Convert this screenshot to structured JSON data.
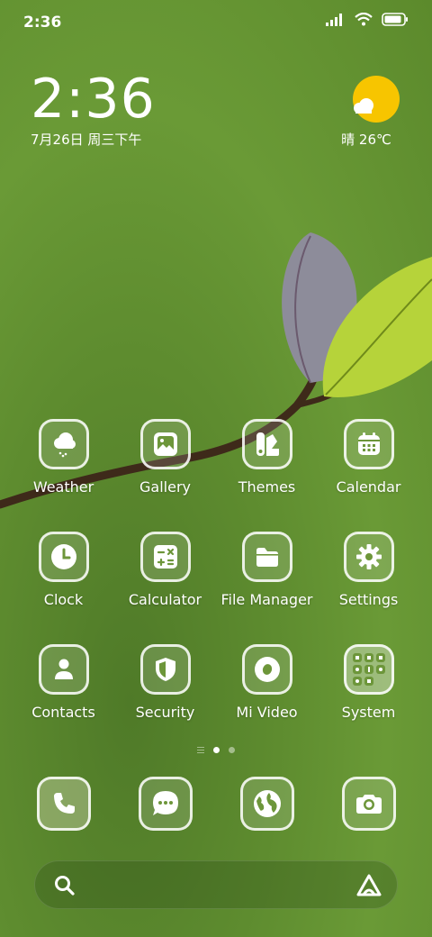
{
  "status_bar": {
    "time": "2:36",
    "battery_level": 0.9
  },
  "clock_widget": {
    "time": "2:36",
    "date": "7月26日 周三下午"
  },
  "weather_widget": {
    "text": "晴 26℃"
  },
  "apps": [
    {
      "label": "Weather",
      "icon": "weather-icon"
    },
    {
      "label": "Gallery",
      "icon": "gallery-icon"
    },
    {
      "label": "Themes",
      "icon": "themes-icon"
    },
    {
      "label": "Calendar",
      "icon": "calendar-icon"
    },
    {
      "label": "Clock",
      "icon": "clock-icon"
    },
    {
      "label": "Calculator",
      "icon": "calculator-icon"
    },
    {
      "label": "File Manager",
      "icon": "folder-icon"
    },
    {
      "label": "Settings",
      "icon": "gear-icon"
    },
    {
      "label": "Contacts",
      "icon": "person-icon"
    },
    {
      "label": "Security",
      "icon": "shield-icon"
    },
    {
      "label": "Mi Video",
      "icon": "video-icon"
    },
    {
      "label": "System",
      "icon": "folder-grid-icon"
    }
  ],
  "page_indicator": {
    "pages": 2,
    "current": 1
  },
  "dock": [
    {
      "icon": "phone-icon"
    },
    {
      "icon": "message-icon"
    },
    {
      "icon": "browser-icon"
    },
    {
      "icon": "camera-icon"
    }
  ],
  "colors": {
    "sun": "#f7c500",
    "wallpaper": "#5e8c2f"
  }
}
